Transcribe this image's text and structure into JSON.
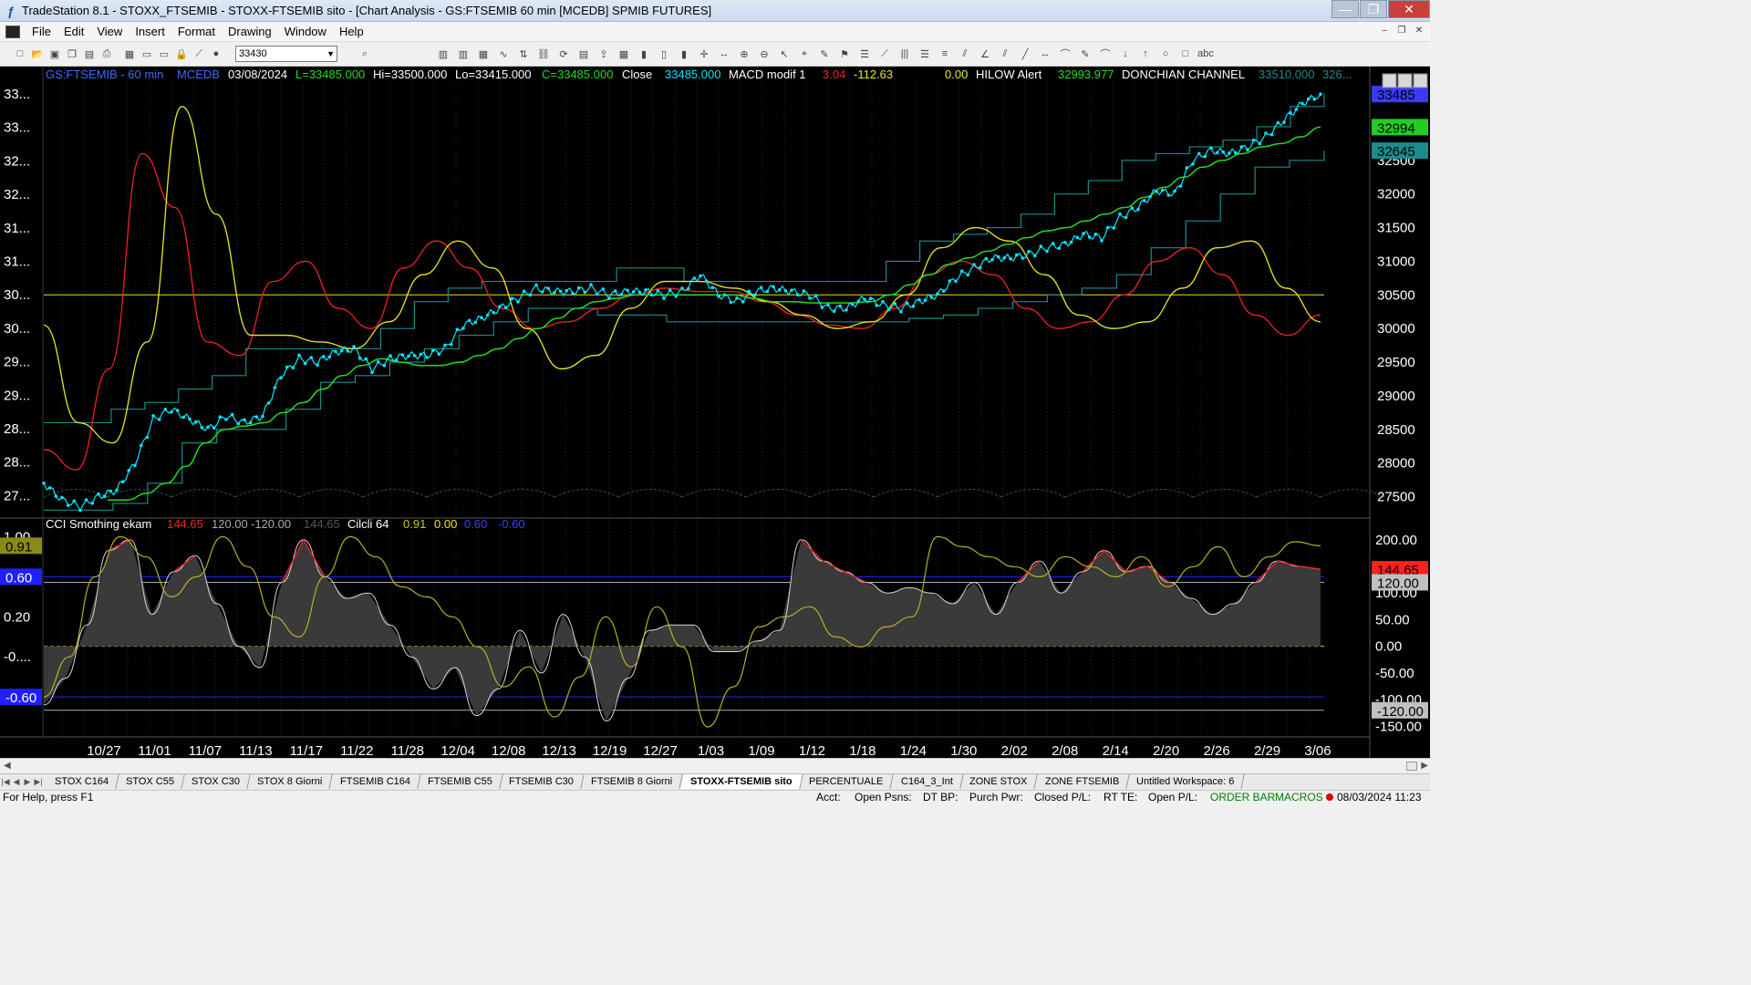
{
  "window": {
    "title": "TradeStation 8.1 - STOXX_FTSEMIB - STOXX-FTSEMIB sito - [Chart Analysis - GS:FTSEMIB  60 min  [MCEDB] SPMIB FUTURES]",
    "minimize": "—",
    "maximize": "❐",
    "close": "✕"
  },
  "menu": [
    "File",
    "Edit",
    "View",
    "Insert",
    "Format",
    "Drawing",
    "Window",
    "Help"
  ],
  "toolbar": {
    "symbol_value": "33430",
    "icons": [
      "new-icon",
      "open-icon",
      "save-icon",
      "copy-icon",
      "paste-icon",
      "print-icon",
      "print-preview-icon",
      "window-icon",
      "window2-icon",
      "lock-icon",
      "chart-icon",
      "globe-icon",
      "search-icon",
      "layout-icon",
      "layout2-icon",
      "table-icon",
      "indicator-icon",
      "strategy-icon",
      "link-icon",
      "refresh-icon",
      "workspace-icon",
      "export-icon",
      "grid-icon",
      "bar-icon",
      "candle-icon",
      "volume-icon",
      "crosshair-icon",
      "measure-icon",
      "zoom-in-icon",
      "zoom-out-icon",
      "pointer-icon",
      "cursor-icon",
      "tools-icon",
      "alert-icon",
      "options-icon",
      "trendline-icon",
      "vertical-lines-icon",
      "horizontal-lines-icon",
      "fib-icon",
      "channel-icon",
      "gann-icon",
      "parallel-icon",
      "speed-icon",
      "arrow-line-icon",
      "arc-icon",
      "pencil-icon",
      "curve-icon",
      "down-arrow-icon",
      "up-arrow-icon",
      "ellipse-icon",
      "rectangle-icon",
      "text-icon"
    ]
  },
  "chart": {
    "header": {
      "symbol": "GS:FTSEMIB - 60 min",
      "data_source": "MCEDB",
      "date": "03/08/2024",
      "last": "L=33485.000",
      "high": "Hi=33500.000",
      "low": "Lo=33415.000",
      "close": "C=33485.000",
      "close_label": "Close",
      "close_value": "33485.000",
      "macd_label": "MACD modif 1",
      "macd_v1": "3.04",
      "macd_v2": "-112.63",
      "macd_v3": "0.00",
      "hilow_label": "HILOW Alert",
      "hilow_value": "32993.977",
      "donchian_label": "DONCHIAN CHANNEL",
      "donchian_v1": "33510.000",
      "donchian_v2": "326..."
    },
    "lower_header": {
      "cci_label": "CCI Smothing ekam",
      "cci_v1": "144.65",
      "cci_v2": "120.00",
      "cci_v3": "-120.00",
      "cci_v4": "144.65",
      "cicli_label": "Cilcli 64",
      "cicli_v1": "0.91",
      "cicli_v2": "0.00",
      "cicli_v3": "0.60",
      "cicli_v4": "-0.60"
    },
    "left_axis_upper": [
      "33...",
      "33...",
      "32...",
      "32...",
      "31...",
      "31...",
      "30...",
      "30...",
      "29...",
      "29...",
      "28...",
      "28...",
      "27..."
    ],
    "left_axis_lower": [
      "1.00",
      "0.91",
      "0.60",
      "0.20",
      "-0....",
      "-0.60"
    ],
    "right_axis_upper": [
      "32500",
      "32000",
      "31500",
      "31000",
      "30500",
      "30000",
      "29500",
      "29000",
      "28500",
      "28000",
      "27500"
    ],
    "right_axis_lower": [
      "200.00",
      "100.00",
      "50.00",
      "0.00",
      "-50.00",
      "-100.00",
      "-150.00"
    ],
    "price_tags": [
      {
        "text": "33485",
        "bg": "#3a3aff"
      },
      {
        "text": "32994",
        "bg": "#22cc22"
      },
      {
        "text": "32645",
        "bg": "#1a8c8c"
      }
    ],
    "lower_tags": [
      {
        "text": "144.65",
        "bg": "#ff2020"
      },
      {
        "text": "120.00",
        "bg": "#c0c0c0"
      },
      {
        "text": "-120.00",
        "bg": "#c0c0c0"
      }
    ],
    "left_lower_tags": [
      {
        "text": "0.91",
        "bg": "#8a8a1a"
      },
      {
        "text": "0.60",
        "bg": "#2020ff"
      },
      {
        "text": "-0.60",
        "bg": "#2020ff"
      }
    ],
    "x_labels": [
      "10/27",
      "11/01",
      "11/07",
      "11/13",
      "11/17",
      "11/22",
      "11/28",
      "12/04",
      "12/08",
      "12/13",
      "12/19",
      "12/27",
      "1/03",
      "1/09",
      "1/12",
      "1/18",
      "1/24",
      "1/30",
      "2/02",
      "2/08",
      "2/14",
      "2/20",
      "2/26",
      "2/29",
      "3/06"
    ],
    "colors": {
      "price": "#00e5ff",
      "donchian": "#1a8c8c",
      "hilow": "#22dd22",
      "macd_red": "#ee2222",
      "cycle_yellow": "#e8e820",
      "mid_line": "#c8c820",
      "cci_fill": "#3a3a3a",
      "cci_line": "#d8d8d8"
    }
  },
  "chart_data": {
    "type": "line",
    "ylim": [
      27250,
      33650
    ],
    "price": [
      27700,
      27450,
      27350,
      27500,
      27600,
      28000,
      28650,
      28800,
      28650,
      28500,
      28700,
      28600,
      28700,
      29300,
      29550,
      29500,
      29650,
      29700,
      29400,
      29550,
      29600,
      29600,
      29700,
      30050,
      30150,
      30300,
      30450,
      30600,
      30550,
      30550,
      30600,
      30500,
      30550,
      30550,
      30500,
      30550,
      30800,
      30500,
      30400,
      30550,
      30600,
      30550,
      30500,
      30300,
      30300,
      30450,
      30350,
      30300,
      30400,
      30500,
      30750,
      30900,
      31050,
      31050,
      31100,
      31200,
      31250,
      31400,
      31350,
      31650,
      31800,
      32050,
      32000,
      32500,
      32650,
      32600,
      32700,
      32850,
      33100,
      33350,
      33485
    ],
    "hilow": [
      27450,
      27450,
      27550,
      27700,
      27950,
      28300,
      28500,
      28550,
      28600,
      28750,
      28900,
      29100,
      29300,
      29450,
      29550,
      29500,
      29450,
      29450,
      29500,
      29600,
      29700,
      29850,
      30000,
      30150,
      30300,
      30400,
      30450,
      30500,
      30500,
      30500,
      30500,
      30500,
      30500,
      30450,
      30400,
      30400,
      30380,
      30380,
      30380,
      30400,
      30500,
      30650,
      30800,
      30950,
      31050,
      31150,
      31250,
      31350,
      31450,
      31500,
      31600,
      31700,
      31800,
      31950,
      32100,
      32250,
      32400,
      32500,
      32600,
      32700,
      32750,
      32850,
      32994
    ],
    "donchian_upper": [
      28600,
      28600,
      28800,
      28900,
      29100,
      29300,
      29700,
      29700,
      29700,
      29700,
      30000,
      30400,
      30600,
      30700,
      30700,
      30700,
      30700,
      30900,
      30900,
      30700,
      30700,
      30700,
      30700,
      30700,
      30700,
      31000,
      31300,
      31400,
      31500,
      31700,
      32000,
      32200,
      32500,
      32600,
      32700,
      32800,
      33000,
      33300,
      33500
    ],
    "donchian_lower": [
      27300,
      27300,
      27400,
      27700,
      28300,
      28500,
      28500,
      28800,
      29200,
      29300,
      29500,
      29700,
      29900,
      30100,
      30300,
      30300,
      30200,
      30200,
      30100,
      30100,
      30100,
      30100,
      30100,
      30100,
      30100,
      30150,
      30200,
      30300,
      30400,
      30500,
      30600,
      30800,
      31200,
      31600,
      32000,
      32400,
      32500,
      32645
    ],
    "macd_red": [
      28200,
      27900,
      29400,
      32600,
      31800,
      29800,
      29600,
      30700,
      31000,
      30300,
      30000,
      30900,
      31300,
      30900,
      30300,
      30000,
      30100,
      30300,
      30500,
      30600,
      30550,
      30550,
      30400,
      30200,
      30050,
      30000,
      30300,
      30800,
      31000,
      30800,
      30300,
      30000,
      30100,
      30500,
      31000,
      31200,
      30800,
      30200,
      29900,
      30200
    ],
    "cycle_yellow": [
      30050,
      28600,
      28300,
      29800,
      33300,
      31700,
      29900,
      29900,
      29800,
      29700,
      30100,
      30800,
      31300,
      30900,
      30000,
      29400,
      29600,
      30300,
      30700,
      30700,
      30600,
      30400,
      30200,
      30000,
      30100,
      30500,
      31200,
      31500,
      31300,
      30800,
      30200,
      30000,
      30100,
      30600,
      31200,
      31300,
      30600,
      30100
    ],
    "cci": [
      -110,
      -60,
      40,
      180,
      200,
      60,
      140,
      170,
      80,
      0,
      -40,
      120,
      200,
      130,
      90,
      100,
      40,
      -20,
      -80,
      -40,
      -130,
      -80,
      30,
      -50,
      60,
      -20,
      -140,
      -60,
      30,
      40,
      40,
      -10,
      -10,
      10,
      30,
      200,
      160,
      140,
      120,
      100,
      110,
      100,
      80,
      120,
      60,
      120,
      160,
      100,
      140,
      180,
      140,
      150,
      120,
      90,
      60,
      80,
      120,
      160,
      150,
      144.65
    ],
    "cycle_lower": [
      -0.6,
      -0.2,
      0.6,
      1.0,
      0.8,
      0.4,
      0.6,
      1.0,
      0.7,
      0.2,
      0.0,
      0.6,
      1.0,
      0.8,
      0.5,
      0.4,
      0.2,
      -0.1,
      -0.5,
      -0.3,
      -0.8,
      -0.4,
      0.2,
      -0.3,
      0.3,
      -0.1,
      -0.9,
      -0.5,
      0.1,
      0.2,
      0.3,
      0.0,
      -0.1,
      0.1,
      0.2,
      1.0,
      0.9,
      0.8,
      0.7,
      0.6,
      0.8,
      0.7,
      0.6,
      0.8,
      0.5,
      0.7,
      0.9,
      0.6,
      0.8,
      0.95,
      0.91
    ]
  },
  "tabs": [
    "STOX C164",
    "STOX C55",
    "STOX  C30",
    "STOX  8 Giorni",
    "FTSEMIB C164",
    "FTSEMIB C55",
    "FTSEMIB C30",
    "FTSEMIB  8 Giorni",
    "STOXX-FTSEMIB sito",
    "PERCENTUALE",
    "C164_3_Int",
    "ZONE STOX",
    "ZONE FTSEMIB",
    "Untitled Workspace:  6"
  ],
  "tabs_active": "STOXX-FTSEMIB sito",
  "status": {
    "help": "For Help, press F1",
    "acct": "Acct:",
    "open_psns": "Open Psns:",
    "dt_bp": "DT BP:",
    "purch_pwr": "Purch Pwr:",
    "closed_pl": "Closed P/L:",
    "rt_te": "RT TE:",
    "open_pl": "Open P/L:",
    "order_bar": "ORDER BAR",
    "macros": "MACROS",
    "datetime": "08/03/2024 11:23"
  }
}
